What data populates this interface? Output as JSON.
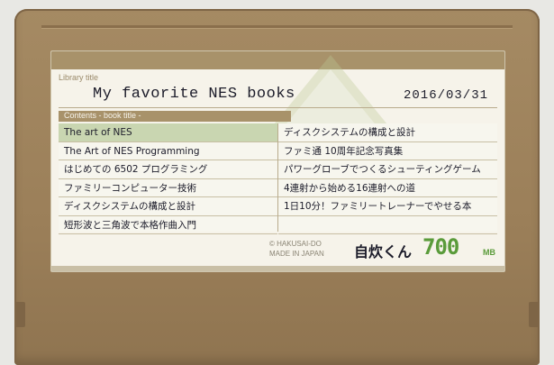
{
  "label": {
    "library_caption": "Library title",
    "library_title": "My favorite NES books",
    "date": "2016/03/31",
    "contents_caption": "Contents - book title -",
    "contents_left": [
      "The art of NES",
      "The Art of NES Programming",
      "はじめての 6502 プログラミング",
      "ファミリーコンピューター技術",
      "ディスクシステムの構成と設計",
      "短形波と三角波で本格作曲入門"
    ],
    "contents_right": [
      "ディスクシステムの構成と設計",
      "ファミ通 10周年記念写真集",
      "パワーグローブでつくるシューティングゲーム",
      "4連射から始める16連射への道",
      "1日10分！ファミリートレーナーでやせる本",
      ""
    ],
    "copyright_line1": "© HAKUSAI-DO",
    "copyright_line2": "MADE IN JAPAN",
    "brand_name": "自炊くん",
    "capacity": "700",
    "capacity_unit": "MB"
  },
  "colors": {
    "cartridge": "#9b7f59",
    "label_bg": "#f6f3ea",
    "accent_green": "#5a9b3a",
    "header_band": "#a8926a"
  }
}
